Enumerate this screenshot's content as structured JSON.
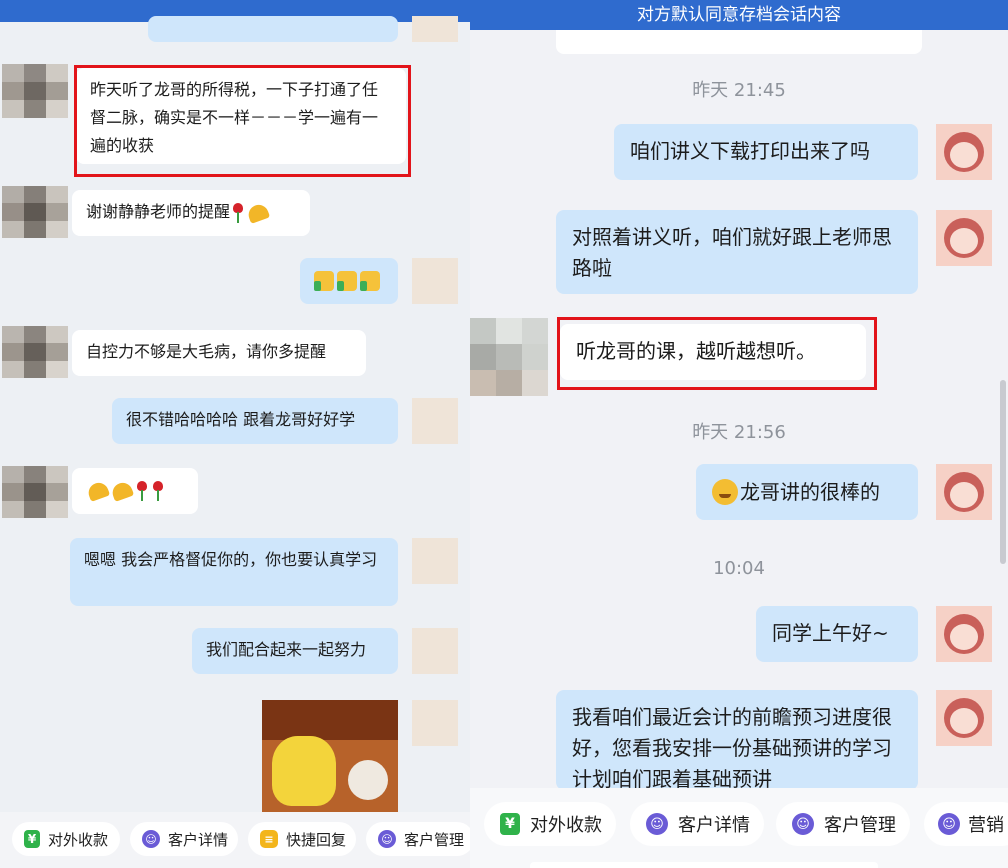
{
  "left": {
    "messages": [
      {
        "side": "in",
        "text": "昨天听了龙哥的所得税，一下子打通了任督二脉，确实是不一样－－－学一遍有一遍的收获",
        "highlighted": true
      },
      {
        "side": "in",
        "text": "谢谢静静老师的提醒"
      },
      {
        "side": "out",
        "text": ""
      },
      {
        "side": "in",
        "text": "自控力不够是大毛病，请你多提醒"
      },
      {
        "side": "out",
        "text": "很不错哈哈哈哈  跟着龙哥好好学"
      },
      {
        "side": "in",
        "text": ""
      },
      {
        "side": "out",
        "text": "嗯嗯  我会严格督促你的，你也要认真学习"
      },
      {
        "side": "out",
        "text": "我们配合起来一起努力"
      }
    ],
    "toolbar": [
      {
        "label": "对外收款",
        "icon": "yuan-icon",
        "color": "#2fb24a"
      },
      {
        "label": "客户详情",
        "icon": "customer-icon",
        "color": "#6a5bd6"
      },
      {
        "label": "快捷回复",
        "icon": "quick-reply-icon",
        "color": "#f3b51b"
      },
      {
        "label": "客户管理",
        "icon": "customer-icon",
        "color": "#6a5bd6"
      }
    ]
  },
  "right": {
    "banner": "对方默认同意存档会话内容",
    "times": [
      "昨天  21:45",
      "昨天  21:56",
      "10:04"
    ],
    "messages": [
      {
        "side": "out",
        "text": "咱们讲义下载打印出来了吗"
      },
      {
        "side": "out",
        "text": "对照着讲义听，咱们就好跟上老师思路啦"
      },
      {
        "side": "in",
        "text": "听龙哥的课，越听越想听。",
        "highlighted": true
      },
      {
        "side": "out",
        "text": "龙哥讲的很棒的"
      },
      {
        "side": "out",
        "text": "同学上午好~"
      },
      {
        "side": "out",
        "text": "我看咱们最近会计的前瞻预习进度很好，您看我安排一份基础预讲的学习计划咱们跟着基础预讲"
      }
    ],
    "toolbar": [
      {
        "label": "对外收款",
        "icon": "yuan-icon",
        "color": "#2fb24a"
      },
      {
        "label": "客户详情",
        "icon": "customer-icon",
        "color": "#6a5bd6"
      },
      {
        "label": "客户管理",
        "icon": "customer-icon",
        "color": "#6a5bd6"
      },
      {
        "label": "营销",
        "icon": "customer-icon",
        "color": "#6a5bd6"
      }
    ]
  },
  "colors": {
    "accent": "#2f6bce",
    "bubble_out": "#cfe6fb",
    "bubble_in": "#ffffff",
    "highlight": "#e2141a"
  }
}
